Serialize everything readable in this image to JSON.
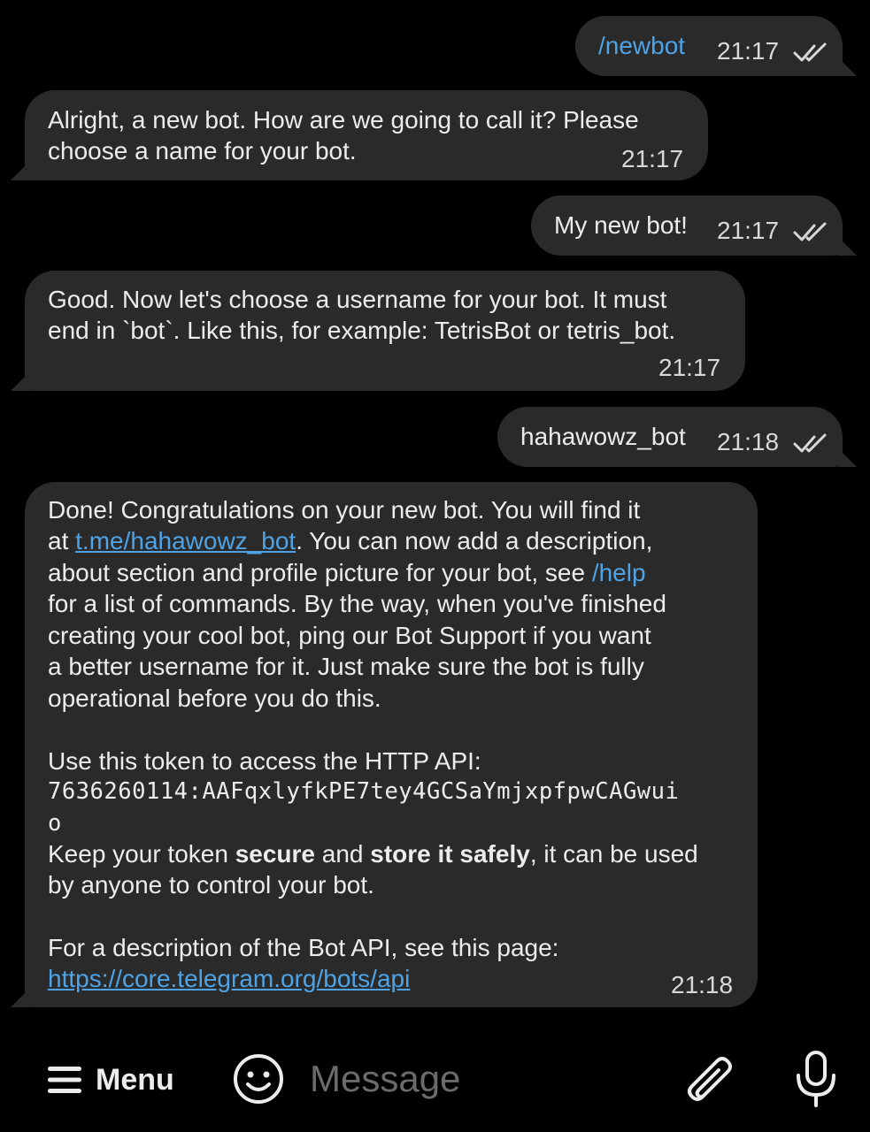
{
  "messages": [
    {
      "dir": "out",
      "text": "/newbot",
      "time": "21:17",
      "read": true
    },
    {
      "dir": "in",
      "lines": [
        "Alright, a new bot. How are we going to call it? Please",
        "choose a name for your bot."
      ],
      "time": "21:17"
    },
    {
      "dir": "out",
      "text": "My new bot!",
      "time": "21:17",
      "read": true
    },
    {
      "dir": "in",
      "lines": [
        "Good. Now let's choose a username for your bot. It must",
        "end in `bot`. Like this, for example: TetrisBot or tetris_bot."
      ],
      "time": "21:17"
    },
    {
      "dir": "out",
      "text": "hahawowz_bot",
      "time": "21:18",
      "read": true
    },
    {
      "dir": "in",
      "time": "21:18",
      "l1": "Done! Congratulations on your new bot. You will find it",
      "l2_pre": "at ",
      "l2_link": "t.me/hahawowz_bot",
      "l2_post": ". You can now add a description,",
      "l3_pre": "about section and profile picture for your bot, see ",
      "l3_cmd": "/help",
      "l4": "for a list of commands. By the way, when you've finished",
      "l5": "creating your cool bot, ping our Bot Support if you want",
      "l6": "a better username for it. Just make sure the bot is fully",
      "l7": "operational before you do this.",
      "l8": "Use this token to access the HTTP API:",
      "token_l1": "7636260114:AAFqxlyfkPE7tey4GCSaYmjxpfpwCAGwui",
      "token_l2": "o",
      "l10_pre": "Keep your token ",
      "l10_b1": "secure",
      "l10_mid": " and ",
      "l10_b2": "store it safely",
      "l10_post": ", it can be used",
      "l11": "by anyone to control your bot.",
      "l12": "For a description of the Bot API, see this page:",
      "api_link": "https://core.telegram.org/bots/api"
    }
  ],
  "bottom_bar": {
    "menu_label": "Menu",
    "placeholder": "Message"
  },
  "colors": {
    "background": "#000000",
    "bubble": "#2a2a2a",
    "link": "#4ea3e6",
    "text": "#ececec",
    "placeholder": "#6b6b6b"
  }
}
